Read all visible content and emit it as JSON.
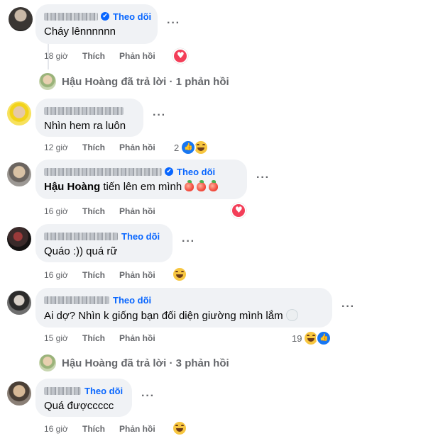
{
  "labels": {
    "follow": "Theo dõi",
    "like": "Thích",
    "reply": "Phản hồi",
    "verified": "✔",
    "more": "···"
  },
  "comments": [
    {
      "text": "Cháy lênnnnnn",
      "time": "18 giờ",
      "reaction_count": ""
    },
    {
      "text": "Nhìn hem ra luôn",
      "time": "12 giờ",
      "reaction_count": "2"
    },
    {
      "mention": "Hậu Hoàng",
      "text": " tiến lên em mình",
      "time": "16 giờ",
      "reaction_count": ""
    },
    {
      "text": "Quáo :)) quá rữ",
      "time": "16 giờ",
      "reaction_count": ""
    },
    {
      "text": "Ai dợ? Nhìn k giống bạn đối diện giường mình lắm",
      "time": "15 giờ",
      "reaction_count": "19"
    },
    {
      "text": "Quá đượccccc",
      "time": "16 giờ",
      "reaction_count": ""
    }
  ],
  "reply_summaries": [
    {
      "text": "Hậu Hoàng đã trả lời · 1 phản hồi"
    },
    {
      "text": "Hậu Hoàng đã trả lời · 3 phản hồi"
    }
  ],
  "colors": {
    "accent": "#0866ff",
    "bubble": "#f0f2f5",
    "muted": "#65676b",
    "heart": "#f33e58",
    "haha": "#f7c640"
  }
}
